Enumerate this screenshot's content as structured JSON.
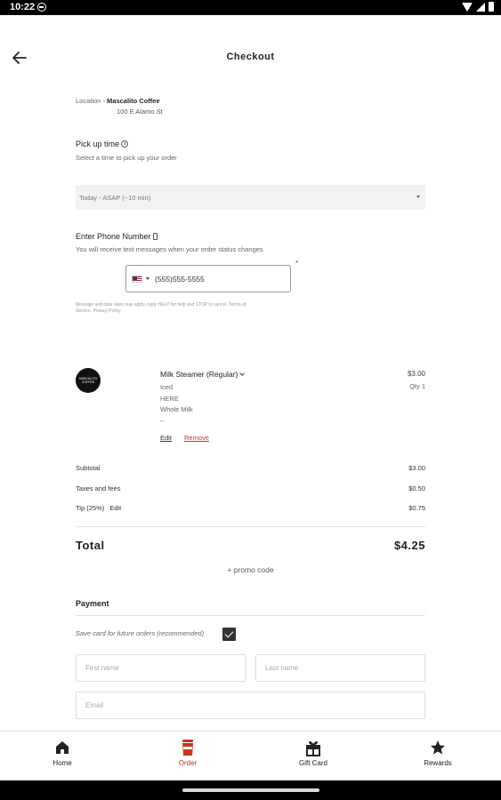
{
  "status_bar": {
    "time": "10:22"
  },
  "header": {
    "title": "Checkout"
  },
  "location": {
    "label": "Location -",
    "store": "Mascalito Coffee",
    "address": "100 E Alamo St"
  },
  "pickup": {
    "title": "Pick up time",
    "subtitle": "Select a time to pick up your order",
    "selected": "Today - ASAP (~10 min)"
  },
  "phone": {
    "title": "Enter Phone Number",
    "subtitle": "You will receive text messages when your order status changes",
    "value": "(555)555-5555",
    "required_mark": "*",
    "disclaimer": "Message and data rates may apply, reply HELP for help and STOP to cancel. Terms of Service, Privacy Policy"
  },
  "cart": {
    "item": {
      "logo_text": "MASCALITO COFFEE",
      "name": "Milk Steamer (Regular)",
      "modifiers": [
        "Iced",
        "HERE",
        "Whole Milk",
        "--"
      ],
      "price": "$3.00",
      "qty": "Qty 1",
      "edit_label": "Edit",
      "remove_label": "Remove"
    }
  },
  "summary": {
    "subtotal_label": "Subtotal",
    "subtotal": "$3.00",
    "taxes_label": "Taxes and fees",
    "taxes": "$0.50",
    "tip_label": "Tip (25%)",
    "tip_edit": "Edit",
    "tip": "$0.75",
    "total_label": "Total",
    "total": "$4.25",
    "promo_label": "+ promo code"
  },
  "payment": {
    "title": "Payment",
    "save_card_label": "Save card for future orders (recommended)",
    "save_card_checked": true,
    "first_name_placeholder": "First name",
    "last_name_placeholder": "Last name",
    "email_placeholder": "Email"
  },
  "bottom_nav": {
    "items": [
      {
        "label": "Home",
        "icon": "home-icon"
      },
      {
        "label": "Order",
        "icon": "cup-icon",
        "active": true
      },
      {
        "label": "Gift Card",
        "icon": "gift-icon"
      },
      {
        "label": "Rewards",
        "icon": "star-icon"
      }
    ]
  },
  "colors": {
    "accent": "#c8361e",
    "required": "#d0311f"
  }
}
